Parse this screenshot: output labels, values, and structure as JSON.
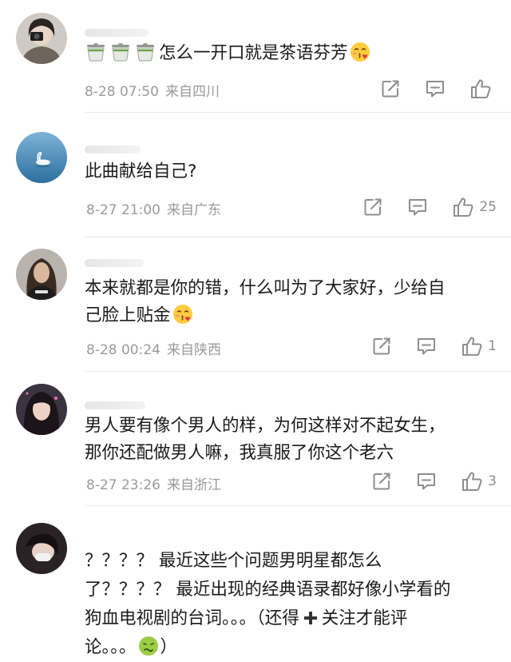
{
  "comments": [
    {
      "text": "怎么一开口就是茶语芬芳",
      "date": "8-28 07:50",
      "location": "来自四川",
      "likes": "",
      "prefix_icons": [
        "tea-icon",
        "tea-icon",
        "tea-icon"
      ],
      "suffix_icon": "kissing-heart-emoji"
    },
    {
      "text": "此曲献给自己?",
      "date": "8-27 21:00",
      "location": "来自广东",
      "likes": "25"
    },
    {
      "text_line1": "本来就都是你的错，什么叫为了大家好，少给自",
      "text_line2": "己脸上贴金",
      "date": "8-28 00:24",
      "location": "来自陕西",
      "likes": "1",
      "suffix_icon": "kissing-heart-emoji"
    },
    {
      "text_line1": "男人要有像个男人的样，为何这样对不起女生，",
      "text_line2": "那你还配做男人嘛，我真服了你这个老六",
      "date": "8-27 23:26",
      "location": "来自浙江",
      "likes": "3"
    },
    {
      "text_line1": "？？？？ 最近这些个问题男明星都怎么",
      "text_line2": "了？？？？ 最近出现的经典语录都好像小学看的",
      "text_line3a": "狗血电视剧的台词。。。（还得",
      "text_line3b": "关注才能评",
      "text_line4a": "论。。。",
      "text_line4b": "）",
      "inline_icons": [
        "plus-icon",
        "nauseated-face-emoji"
      ]
    }
  ],
  "colors": {
    "meta_gray": "#9a9a9a",
    "icon_gray": "#8e8e8e",
    "divider": "#ececec"
  }
}
